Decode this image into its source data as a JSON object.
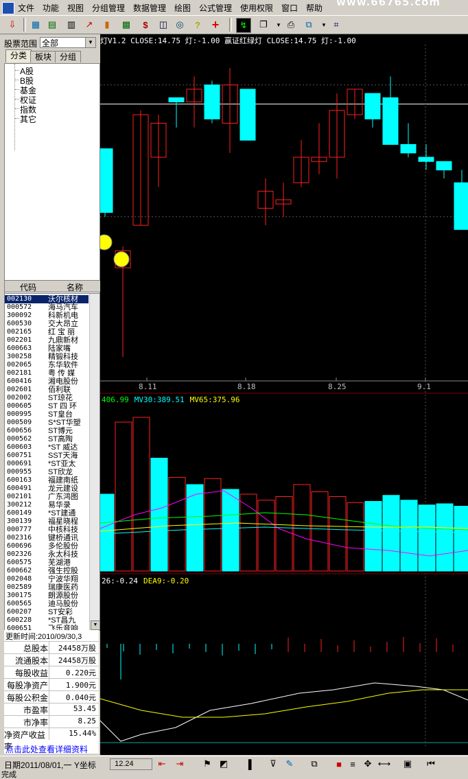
{
  "menu": [
    "文件",
    "功能",
    "视图",
    "分组管理",
    "数据管理",
    "绘图",
    "公式管理",
    "使用权限",
    "窗口",
    "帮助"
  ],
  "watermark": "www.66765.com",
  "left": {
    "range_label": "股票范围",
    "range_value": "全部",
    "tabs": [
      "分类",
      "板块",
      "分组"
    ],
    "tree": [
      "A股",
      "B股",
      "基金",
      "权证",
      "指数",
      "其它"
    ],
    "list_headers": [
      "代码",
      "名称"
    ],
    "stocks": [
      [
        "002130",
        "沃尔核材"
      ],
      [
        "000572",
        "海马汽车"
      ],
      [
        "300092",
        "科新机电"
      ],
      [
        "600530",
        "交大昂立"
      ],
      [
        "002165",
        "红 宝 丽"
      ],
      [
        "002201",
        "九鼎新材"
      ],
      [
        "600663",
        "陆家嘴"
      ],
      [
        "300258",
        "精锻科技"
      ],
      [
        "002065",
        "东华软件"
      ],
      [
        "002181",
        "粤 传 媒"
      ],
      [
        "600416",
        "湘电股份"
      ],
      [
        "002601",
        "佰利联"
      ],
      [
        "002002",
        "ST琼花"
      ],
      [
        "000605",
        "ST 四 环"
      ],
      [
        "000995",
        "ST皇台"
      ],
      [
        "000509",
        "S*ST华塑"
      ],
      [
        "600656",
        "ST博元"
      ],
      [
        "000562",
        "ST高陶"
      ],
      [
        "600603",
        "*ST 威达"
      ],
      [
        "600751",
        "SST天海"
      ],
      [
        "000691",
        "*ST亚太"
      ],
      [
        "000955",
        "ST欣龙"
      ],
      [
        "600163",
        "福建南纸"
      ],
      [
        "600491",
        "龙元建设"
      ],
      [
        "002101",
        "广东鸿图"
      ],
      [
        "300212",
        "易华录"
      ],
      [
        "600149",
        "*ST建通"
      ],
      [
        "300139",
        "福星晓程"
      ],
      [
        "000777",
        "中核科技"
      ],
      [
        "002316",
        "键桥通讯"
      ],
      [
        "600696",
        "多伦股份"
      ],
      [
        "002326",
        "永太科技"
      ],
      [
        "600575",
        "芜湖港"
      ],
      [
        "600662",
        "强生控股"
      ],
      [
        "002048",
        "宁波华翔"
      ],
      [
        "002589",
        "瑞康医药"
      ],
      [
        "300175",
        "朗源股份"
      ],
      [
        "600565",
        "迪马股份"
      ],
      [
        "600207",
        "ST安彩"
      ],
      [
        "600228",
        "*ST昌九"
      ],
      [
        "600651",
        "飞乐音响"
      ]
    ],
    "update_time": "更新时间:2010/09/30,3",
    "info": [
      [
        "总股本",
        "24458万股"
      ],
      [
        "流通股本",
        "24458万股"
      ],
      [
        "每股收益",
        "0.220元"
      ],
      [
        "每股净资产",
        "1.900元"
      ],
      [
        "每股公积金",
        "0.040元"
      ],
      [
        "市盈率",
        "53.45"
      ],
      [
        "市净率",
        "8.25"
      ],
      [
        "净资产收益率",
        "15.44%"
      ]
    ],
    "detail_link": "点击此处查看详细资料"
  },
  "chart": {
    "header1": "灯V1.2 CLOSE:14.75  灯:-1.00  赢证红绿灯 CLOSE:14.75  灯:-1.00",
    "x_labels": [
      "8.11",
      "8.18",
      "8.25",
      "9.1"
    ],
    "vol_header": [
      {
        "text": "406.99",
        "color": "#00ff00"
      },
      {
        "text": "MV30:389.51",
        "color": "#00ffff"
      },
      {
        "text": "MV65:375.96",
        "color": "#ffff00"
      }
    ],
    "macd_header": [
      {
        "text": "26:-0.24",
        "color": "#ffffff"
      },
      {
        "text": "DEA9:-0.20",
        "color": "#ffff00"
      }
    ],
    "colors": {
      "up": "#ff2020",
      "down": "#00ffff",
      "bg": "#000000"
    }
  },
  "chart_data": {
    "type": "candlestick",
    "candles": [
      {
        "o": 14.8,
        "h": 14.8,
        "l": 13.2,
        "c": 13.3,
        "up": false
      },
      {
        "o": 12.0,
        "h": 12.5,
        "l": 9.9,
        "c": 12.4,
        "up": true
      },
      {
        "o": 13.0,
        "h": 15.7,
        "l": 13.0,
        "c": 15.6,
        "up": true
      },
      {
        "o": 14.6,
        "h": 15.6,
        "l": 13.9,
        "c": 15.4,
        "up": true
      },
      {
        "o": 16.0,
        "h": 16.0,
        "l": 15.3,
        "c": 15.9,
        "up": false
      },
      {
        "o": 15.9,
        "h": 16.5,
        "l": 15.3,
        "c": 16.2,
        "up": true
      },
      {
        "o": 16.3,
        "h": 16.4,
        "l": 15.4,
        "c": 15.5,
        "up": false
      },
      {
        "o": 15.4,
        "h": 16.7,
        "l": 14.7,
        "c": 16.3,
        "up": true
      },
      {
        "o": 16.2,
        "h": 16.2,
        "l": 15.0,
        "c": 15.0,
        "up": false
      },
      {
        "o": 13.4,
        "h": 14.1,
        "l": 13.0,
        "c": 13.8,
        "up": true
      },
      {
        "o": 13.5,
        "h": 14.0,
        "l": 13.2,
        "c": 13.6,
        "up": true
      },
      {
        "o": 14.0,
        "h": 15.0,
        "l": 13.9,
        "c": 14.6,
        "up": true
      },
      {
        "o": 14.5,
        "h": 15.4,
        "l": 14.2,
        "c": 14.6,
        "up": true
      },
      {
        "o": 14.6,
        "h": 16.1,
        "l": 14.1,
        "c": 15.7,
        "up": true
      },
      {
        "o": 15.6,
        "h": 16.2,
        "l": 15.5,
        "c": 16.2,
        "up": true
      },
      {
        "o": 16.1,
        "h": 16.1,
        "l": 15.3,
        "c": 15.5,
        "up": false
      },
      {
        "o": 16.0,
        "h": 16.5,
        "l": 14.9,
        "c": 14.9,
        "up": false
      },
      {
        "o": 14.9,
        "h": 15.4,
        "l": 14.6,
        "c": 14.7,
        "up": false
      },
      {
        "o": 14.6,
        "h": 14.9,
        "l": 14.3,
        "c": 14.5,
        "up": false
      },
      {
        "o": 14.5,
        "h": 14.5,
        "l": 14.1,
        "c": 14.3,
        "up": false
      },
      {
        "o": 14.0,
        "h": 14.3,
        "l": 12.9,
        "c": 12.9,
        "up": false
      }
    ],
    "price_line": 15.85,
    "volume": [
      {
        "v": 320,
        "up": false
      },
      {
        "v": 620,
        "up": true
      },
      {
        "v": 640,
        "up": true
      },
      {
        "v": 470,
        "up": false
      },
      {
        "v": 390,
        "up": true
      },
      {
        "v": 360,
        "up": false
      },
      {
        "v": 385,
        "up": true
      },
      {
        "v": 340,
        "up": false
      },
      {
        "v": 320,
        "up": true
      },
      {
        "v": 295,
        "up": true
      },
      {
        "v": 310,
        "up": true
      },
      {
        "v": 360,
        "up": true
      },
      {
        "v": 330,
        "up": true
      },
      {
        "v": 310,
        "up": true
      },
      {
        "v": 285,
        "up": true
      },
      {
        "v": 290,
        "up": false
      },
      {
        "v": 315,
        "up": false
      },
      {
        "v": 295,
        "up": false
      },
      {
        "v": 275,
        "up": false
      },
      {
        "v": 280,
        "up": false
      },
      {
        "v": 270,
        "up": false
      }
    ],
    "vol_ylim": [
      0,
      720
    ],
    "ylim": [
      9.5,
      17.2
    ]
  }
}
